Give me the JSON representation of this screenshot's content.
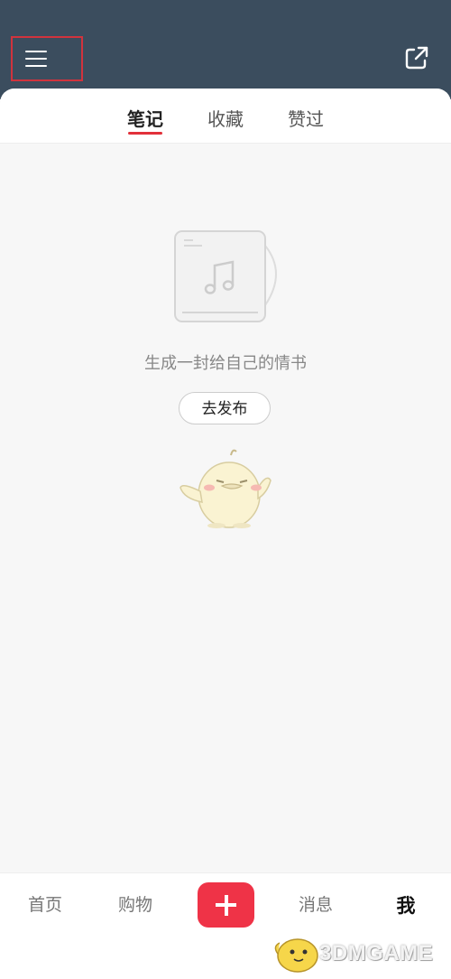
{
  "header": {
    "menu_icon": "hamburger-menu-icon",
    "share_icon": "share-external-icon"
  },
  "tabs": [
    {
      "label": "笔记",
      "active": true
    },
    {
      "label": "收藏",
      "active": false
    },
    {
      "label": "赞过",
      "active": false
    }
  ],
  "empty_state": {
    "illustration": "music-album-icon",
    "message": "生成一封给自己的情书",
    "button_label": "去发布",
    "mascot": "yellow-bird-mascot"
  },
  "bottom_nav": {
    "items": [
      {
        "label": "首页"
      },
      {
        "label": "购物"
      },
      {
        "label": "消息"
      },
      {
        "label": "我",
        "active": true
      }
    ],
    "plus_icon": "plus-icon"
  },
  "watermark": {
    "text": "3DMGAME"
  },
  "colors": {
    "topbar": "#3b4d5e",
    "accent": "#ef3347",
    "highlight_box": "#d1333d"
  }
}
